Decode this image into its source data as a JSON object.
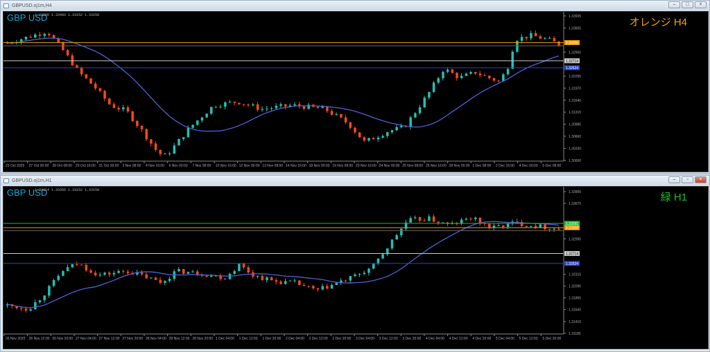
{
  "colors": {
    "up": "#23c0b4",
    "down": "#ff4a14",
    "ma": "#4a62d8",
    "grid": "#777"
  },
  "h4": {
    "window_title": "GBPUSD.oj1m,H4",
    "symbol": "GBP USD",
    "ohlc_info": "1.33206 1.33403 1.33152 1.33158",
    "tag": "オレンジ H4",
    "tag_color": "#f5a000",
    "price_min": 1.3,
    "price_max": 1.33935,
    "price_labels": [
      "1.33935",
      "1.33605",
      "1.32950",
      "1.32295",
      "1.31970",
      "1.31640",
      "1.31315",
      "1.30985",
      "1.30660",
      "1.30330",
      "1.30000"
    ],
    "levels": [
      {
        "price": 1.33208,
        "label": "1.33208",
        "color": "#f5a000"
      },
      {
        "price": 1.3312,
        "label": "",
        "color": "#666"
      },
      {
        "price": 1.32714,
        "label": "1.32714",
        "color": "#cccccc"
      },
      {
        "price": 1.32524,
        "label": "1.32524",
        "color": "#2a46c8"
      }
    ],
    "time_labels": [
      "23 Oct 2025",
      "27 Oct 00:00",
      "28 Oct 08:00",
      "29 Oct 16:00",
      "31 Oct 00:00",
      "3 Nov 08:00",
      "4 Nov 16:00",
      "6 Nov 00:00",
      "7 Nov 08:00",
      "10 Nov 16:00",
      "12 Nov 00:00",
      "13 Nov 08:00",
      "14 Nov 16:00",
      "18 Nov 00:00",
      "19 Nov 08:00",
      "20 Nov 16:00",
      "24 Nov 00:00",
      "25 Nov 08:00",
      "26 Nov 16:00",
      "28 Nov 00:00",
      "1 Dec 08:00",
      "2 Dec 16:00",
      "4 Dec 00:00",
      "5 Dec 08:00"
    ],
    "candles": 120,
    "path": [
      [
        0,
        1.332
      ],
      [
        8,
        1.3345
      ],
      [
        10,
        1.3352
      ],
      [
        14,
        1.33
      ],
      [
        18,
        1.324
      ],
      [
        22,
        1.32
      ],
      [
        26,
        1.315
      ],
      [
        30,
        1.3135
      ],
      [
        34,
        1.308
      ],
      [
        38,
        1.302
      ],
      [
        40,
        1.3012
      ],
      [
        46,
        1.309
      ],
      [
        52,
        1.315
      ],
      [
        58,
        1.316
      ],
      [
        64,
        1.314
      ],
      [
        72,
        1.315
      ],
      [
        80,
        1.314
      ],
      [
        86,
        1.31
      ],
      [
        90,
        1.305
      ],
      [
        96,
        1.308
      ],
      [
        100,
        1.309
      ],
      [
        106,
        1.318
      ],
      [
        110,
        1.325
      ],
      [
        114,
        1.3225
      ],
      [
        118,
        1.324
      ],
      [
        120,
        1.323
      ],
      [
        124,
        1.3215
      ],
      [
        126,
        1.325
      ],
      [
        128,
        1.333
      ],
      [
        132,
        1.334
      ],
      [
        136,
        1.333
      ],
      [
        139,
        1.3316
      ]
    ]
  },
  "h1": {
    "window_title": "GBPUSD.oj1m,H1",
    "symbol": "GBP USD",
    "ohlc_info": "1.33314 1.33356 1.33152 1.33158",
    "tag": "緑 H1",
    "tag_color": "#1fbf2a",
    "price_min": 1.31185,
    "price_max": 1.339,
    "price_labels": [
      "1.33900",
      "1.33675",
      "1.32995",
      "1.32315",
      "1.32090",
      "1.31865",
      "1.31640",
      "1.31410",
      "1.31185"
    ],
    "levels": [
      {
        "price": 1.33291,
        "label": "1.33291",
        "color": "#1fbf2a"
      },
      {
        "price": 1.33208,
        "label": "1.33208",
        "color": "#f5a000"
      },
      {
        "price": 1.3315,
        "label": "",
        "color": "#666"
      },
      {
        "price": 1.32714,
        "label": "1.32714",
        "color": "#cccccc"
      },
      {
        "price": 1.32524,
        "label": "1.32524",
        "color": "#2a46c8"
      }
    ],
    "time_labels": [
      "26 Nov 2025",
      "26 Nov 12:00",
      "26 Nov 20:00",
      "27 Nov 04:00",
      "27 Nov 12:00",
      "27 Nov 20:00",
      "28 Nov 04:00",
      "28 Nov 12:00",
      "28 Nov 20:00",
      "1 Dec 04:00",
      "1 Dec 12:00",
      "1 Dec 20:00",
      "2 Dec 04:00",
      "2 Dec 12:00",
      "2 Dec 20:00",
      "3 Dec 04:00",
      "3 Dec 12:00",
      "3 Dec 20:00",
      "4 Dec 04:00",
      "4 Dec 12:00",
      "4 Dec 20:00",
      "5 Dec 04:00",
      "5 Dec 12:00",
      "5 Dec 20:00"
    ],
    "candles": 120,
    "path": [
      [
        0,
        1.3172
      ],
      [
        6,
        1.3165
      ],
      [
        10,
        1.319
      ],
      [
        16,
        1.324
      ],
      [
        20,
        1.3252
      ],
      [
        26,
        1.323
      ],
      [
        34,
        1.3238
      ],
      [
        40,
        1.3225
      ],
      [
        44,
        1.3215
      ],
      [
        48,
        1.3238
      ],
      [
        56,
        1.3232
      ],
      [
        62,
        1.3225
      ],
      [
        66,
        1.325
      ],
      [
        70,
        1.323
      ],
      [
        76,
        1.3218
      ],
      [
        82,
        1.3215
      ],
      [
        88,
        1.32
      ],
      [
        92,
        1.321
      ],
      [
        98,
        1.3225
      ],
      [
        104,
        1.3245
      ],
      [
        110,
        1.33
      ],
      [
        114,
        1.3335
      ],
      [
        120,
        1.3338
      ],
      [
        126,
        1.3325
      ],
      [
        132,
        1.334
      ],
      [
        138,
        1.332
      ],
      [
        144,
        1.333
      ],
      [
        150,
        1.3325
      ],
      [
        157,
        1.3318
      ]
    ]
  }
}
